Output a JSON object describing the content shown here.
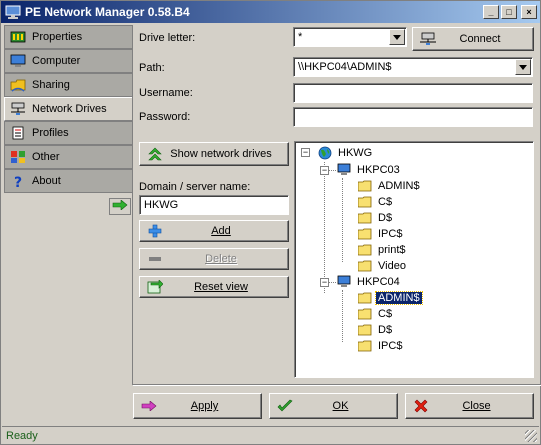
{
  "window": {
    "title": "PE Network Manager 0.58.B4",
    "minimize": "_",
    "maximize": "□",
    "close": "×"
  },
  "sidebar": {
    "items": [
      {
        "label": "Properties",
        "icon": "properties-icon"
      },
      {
        "label": "Computer",
        "icon": "computer-icon"
      },
      {
        "label": "Sharing",
        "icon": "sharing-icon"
      },
      {
        "label": "Network Drives",
        "icon": "network-drives-icon",
        "active": true
      },
      {
        "label": "Profiles",
        "icon": "profiles-icon"
      },
      {
        "label": "Other",
        "icon": "other-icon"
      },
      {
        "label": "About",
        "icon": "about-icon"
      }
    ]
  },
  "form": {
    "drive_letter_label": "Drive letter:",
    "drive_letter_value": "*",
    "connect_label": "Connect",
    "path_label": "Path:",
    "path_value": "\\\\HKPC04\\ADMIN$",
    "username_label": "Username:",
    "username_value": "",
    "password_label": "Password:",
    "password_value": ""
  },
  "actions": {
    "show_network_drives": "Show network drives",
    "domain_label": "Domain / server name:",
    "domain_value": "HKWG",
    "add_label": "Add",
    "delete_label": "Delete",
    "reset_label": "Reset view"
  },
  "tree": {
    "root": "HKWG",
    "servers": [
      {
        "name": "HKPC03",
        "shares": [
          "ADMIN$",
          "C$",
          "D$",
          "IPC$",
          "print$",
          "Video"
        ]
      },
      {
        "name": "HKPC04",
        "shares": [
          "ADMIN$",
          "C$",
          "D$",
          "IPC$"
        ],
        "selected_share": "ADMIN$"
      }
    ]
  },
  "bottom": {
    "apply_label": "Apply",
    "ok_label": "OK",
    "close_label": "Close"
  },
  "status": {
    "text": "Ready"
  },
  "colors": {
    "title_start": "#0a246a",
    "title_end": "#a6caf0",
    "face": "#d4d0c8",
    "sidebar_inactive": "#aaa9a4",
    "selection": "#0a246a",
    "status_text": "#1a5f1a"
  }
}
